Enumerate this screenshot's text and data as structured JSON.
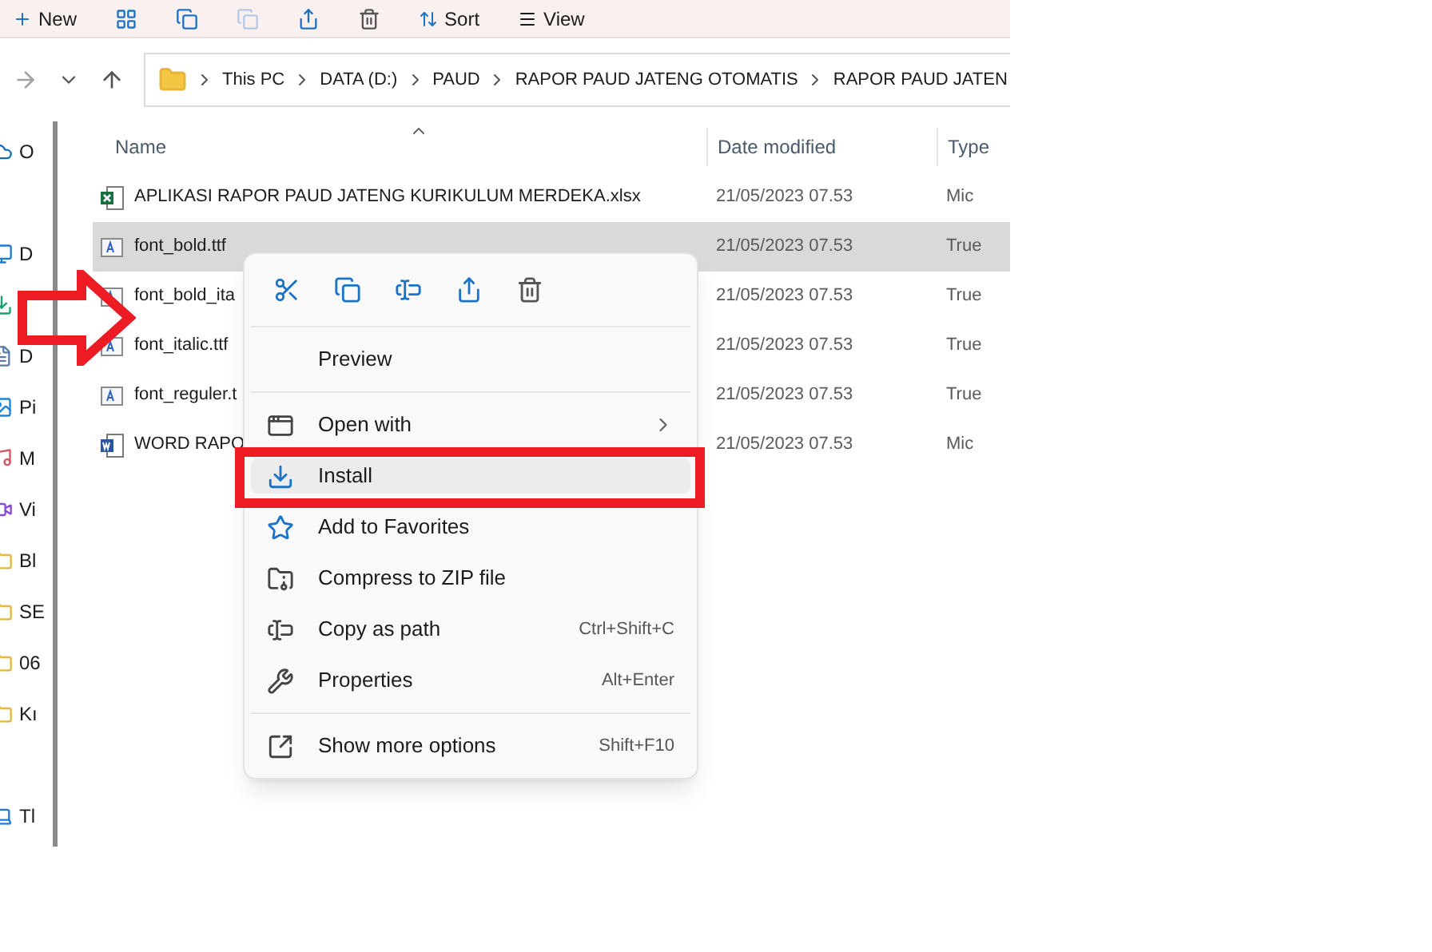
{
  "toolbar": {
    "buttons": [
      "New",
      "Sort",
      "View"
    ]
  },
  "address_bar": {
    "path": [
      "This PC",
      "DATA (D:)",
      "PAUD",
      "RAPOR PAUD JATENG OTOMATIS",
      "RAPOR PAUD JATEN"
    ]
  },
  "sidebar": {
    "items": [
      {
        "kind": "cloud",
        "label": "O"
      },
      {
        "kind": "desktop",
        "label": "D"
      },
      {
        "kind": "download"
      },
      {
        "kind": "documents",
        "label": "D"
      },
      {
        "kind": "pictures",
        "label": "Pi"
      },
      {
        "kind": "music",
        "label": "M"
      },
      {
        "kind": "videos",
        "label": "Vi"
      },
      {
        "kind": "folder",
        "label": "Bl"
      },
      {
        "kind": "folder",
        "label": "SE"
      },
      {
        "kind": "folder",
        "label": "06"
      },
      {
        "kind": "folder",
        "label": "Kı"
      },
      {
        "kind": "pc",
        "label": "Tl"
      }
    ]
  },
  "table": {
    "columns": [
      "Name",
      "Date modified",
      "Type"
    ],
    "rows": [
      {
        "kind": "excel",
        "name": "APLIKASI RAPOR PAUD JATENG KURIKULUM MERDEKA.xlsx",
        "date": "21/05/2023 07.53",
        "type": "Mic",
        "selected": false
      },
      {
        "kind": "font",
        "name": "font_bold.ttf",
        "date": "21/05/2023 07.53",
        "type": "True",
        "selected": true
      },
      {
        "kind": "font",
        "name": "font_bold_ita",
        "date": "21/05/2023 07.53",
        "type": "True",
        "selected": false
      },
      {
        "kind": "font",
        "name": "font_italic.ttf",
        "date": "21/05/2023 07.53",
        "type": "True",
        "selected": false
      },
      {
        "kind": "font",
        "name": "font_reguler.t",
        "date": "21/05/2023 07.53",
        "type": "True",
        "selected": false
      },
      {
        "kind": "word",
        "name": "WORD RAPO",
        "date": "21/05/2023 07.53",
        "type": "Mic",
        "selected": false
      }
    ]
  },
  "context_menu": {
    "sections": [
      [
        {
          "kind": "none",
          "label": "Preview",
          "selected": false
        }
      ],
      [
        {
          "kind": "openwith",
          "label": "Open with",
          "submenu": true,
          "selected": false
        },
        {
          "kind": "install",
          "label": "Install",
          "selected": true
        },
        {
          "kind": "star",
          "label": "Add to Favorites",
          "selected": false
        },
        {
          "kind": "zip",
          "label": "Compress to ZIP file",
          "selected": false
        },
        {
          "kind": "path",
          "label": "Copy as path",
          "shortcut": "Ctrl+Shift+C",
          "selected": false
        },
        {
          "kind": "wrench",
          "label": "Properties",
          "shortcut": "Alt+Enter",
          "selected": false
        }
      ],
      [
        {
          "kind": "more",
          "label": "Show more options",
          "shortcut": "Shift+F10",
          "selected": false
        }
      ]
    ]
  }
}
